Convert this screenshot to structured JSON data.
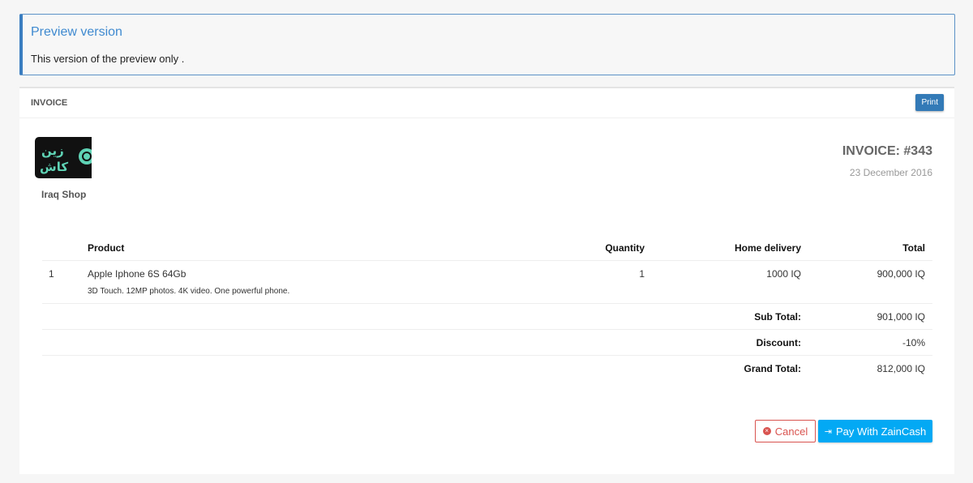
{
  "alert": {
    "title": "Preview version",
    "message": "This version of the preview only ."
  },
  "card": {
    "header": "INVOICE",
    "print_label": "Print"
  },
  "merchant": {
    "name": "Iraq Shop",
    "logo_text": "زين كاش"
  },
  "invoice": {
    "number": "INVOICE: #343",
    "date": "23 December 2016"
  },
  "table": {
    "headers": [
      "",
      "Product",
      "Quantity",
      "Home delivery",
      "Total"
    ],
    "items": [
      {
        "index": "1",
        "product": "Apple Iphone 6S 64Gb",
        "description": "3D Touch. 12MP photos. 4K video. One powerful phone.",
        "quantity": "1",
        "delivery": "1000 IQ",
        "total": "900,000 IQ"
      }
    ],
    "summary": [
      {
        "label": "Sub Total:",
        "value": "901,000 IQ"
      },
      {
        "label": "Discount:",
        "value": "-10%"
      },
      {
        "label": "Grand Total:",
        "value": "812,000 IQ"
      }
    ]
  },
  "actions": {
    "cancel_label": "Cancel",
    "pay_label": "Pay With ZainCash"
  },
  "colors": {
    "accent": "#03a9f4",
    "cancel": "#d9534f",
    "print": "#337ab7",
    "logo_green": "#5fd3b5"
  }
}
